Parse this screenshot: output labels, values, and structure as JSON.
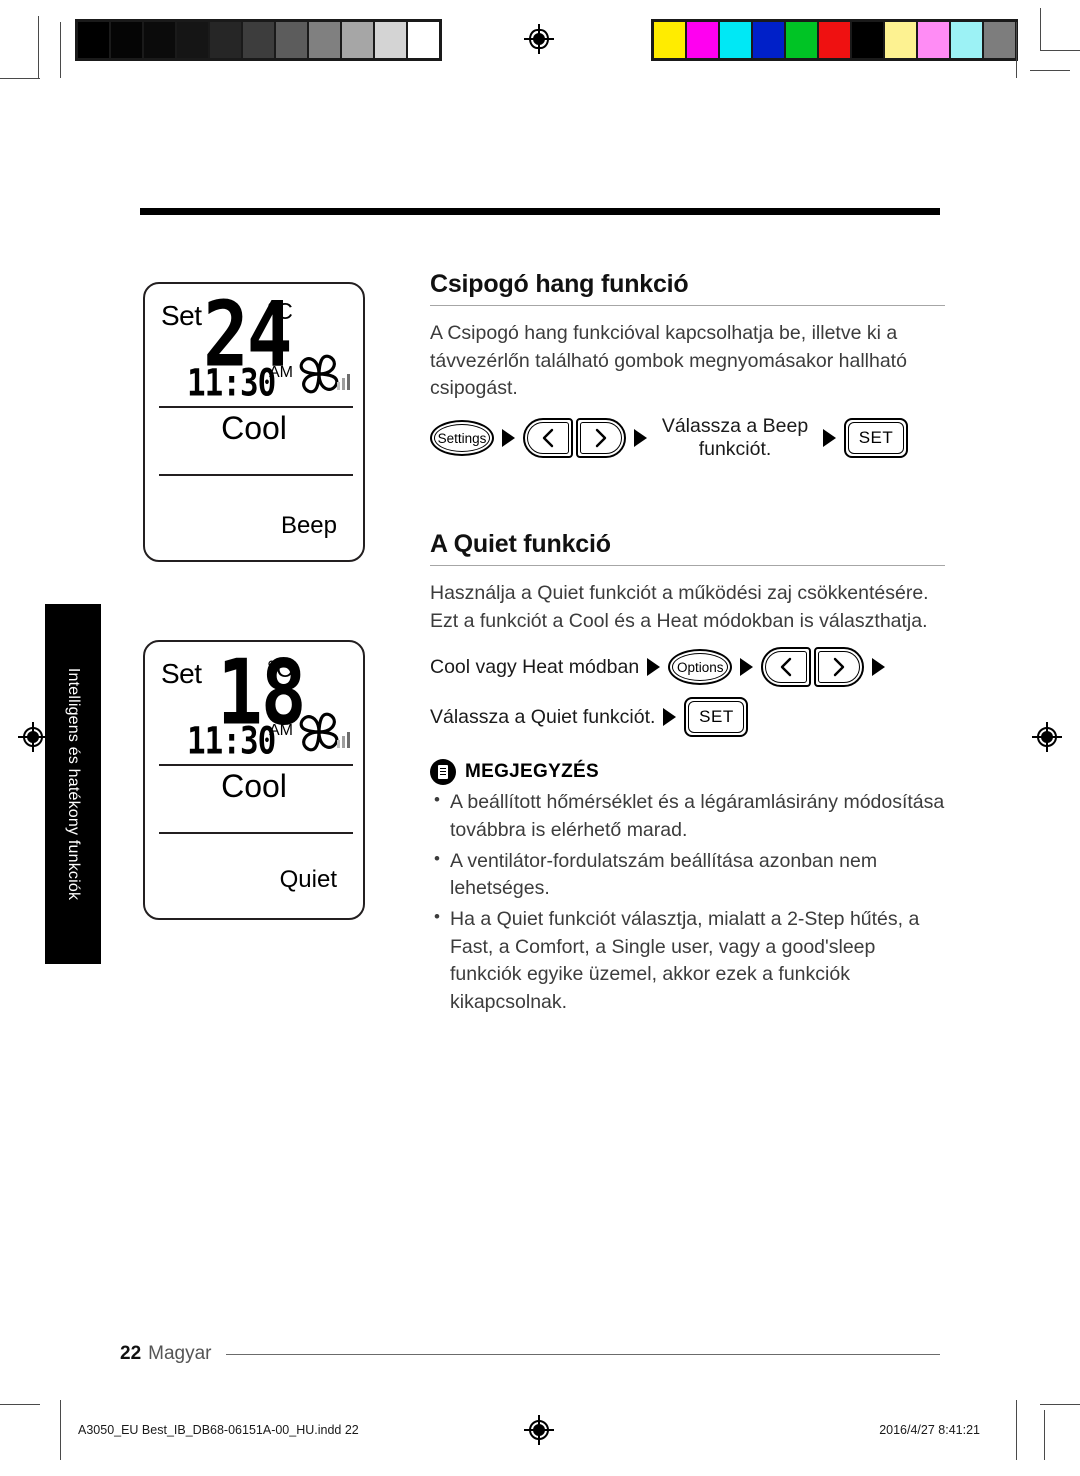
{
  "calibration": {
    "grayscale_bar": [
      "#000000",
      "#050505",
      "#0b0b0b",
      "#151515",
      "#262626",
      "#3d3d3d",
      "#5c5c5c",
      "#808080",
      "#a6a6a6",
      "#d4d4d4",
      "#ffffff"
    ],
    "color_bar": [
      "#ffec00",
      "#ff00f0",
      "#00e8f5",
      "#0020c8",
      "#00c425",
      "#ef1111",
      "#000000",
      "#fdf291",
      "#ff8cf5",
      "#9cf2f5",
      "#7d7d7d"
    ],
    "registration_mark": "registration-target"
  },
  "side_tab": {
    "label": "Intelligens és hatékony funkciók"
  },
  "lcd_beep": {
    "set_label": "Set",
    "temperature": "24",
    "unit": "°C",
    "time": "11:30",
    "ampm": "AM",
    "fan_icon": "fan-icon",
    "fan_bars": 3,
    "mode": "Cool",
    "function": "Beep"
  },
  "lcd_quiet": {
    "set_label": "Set",
    "temperature": "18",
    "unit": "°C",
    "time": "11:30",
    "ampm": "AM",
    "fan_icon": "fan-icon",
    "fan_bars": 3,
    "mode": "Cool",
    "function": "Quiet"
  },
  "section_beep": {
    "title": "Csipogó hang funkció",
    "body": "A Csipogó hang funkcióval kapcsolhatja be, illetve ki a távvezérlőn található gombok megnyomásakor hallható csipogást.",
    "steps": {
      "settings_button": "Settings",
      "left_button": "chevron-left-icon",
      "right_button": "chevron-right-icon",
      "instruction": "Válassza a Beep funkciót.",
      "set_button": "SET"
    }
  },
  "section_quiet": {
    "title": "A Quiet funkció",
    "body": "Használja a Quiet funkciót a működési zaj csökkentésére. Ezt a funkciót a Cool és a Heat módokban is választhatja.",
    "steps": {
      "mode_label": "Cool vagy Heat módban",
      "options_button": "Options",
      "left_button": "chevron-left-icon",
      "right_button": "chevron-right-icon",
      "instruction": "Válassza a Quiet funkciót.",
      "set_button": "SET"
    },
    "note": {
      "icon": "note-document-icon",
      "title": "MEGJEGYZÉS",
      "items": [
        "A beállított hőmérséklet és a légáramlásirány módosítása továbbra is elérhető marad.",
        "A ventilátor-fordulatszám beállítása azonban nem lehetséges.",
        "Ha a Quiet funkciót választja, mialatt a 2-Step hűtés, a Fast, a Comfort, a Single user, vagy a good'sleep funkciók egyike üzemel, akkor ezek a funkciók kikapcsolnak."
      ]
    }
  },
  "footer": {
    "page_number": "22",
    "language": "Magyar",
    "print_file": "A3050_EU Best_IB_DB68-06151A-00_HU.indd   22",
    "print_timestamp": "2016/4/27   8:41:21"
  }
}
